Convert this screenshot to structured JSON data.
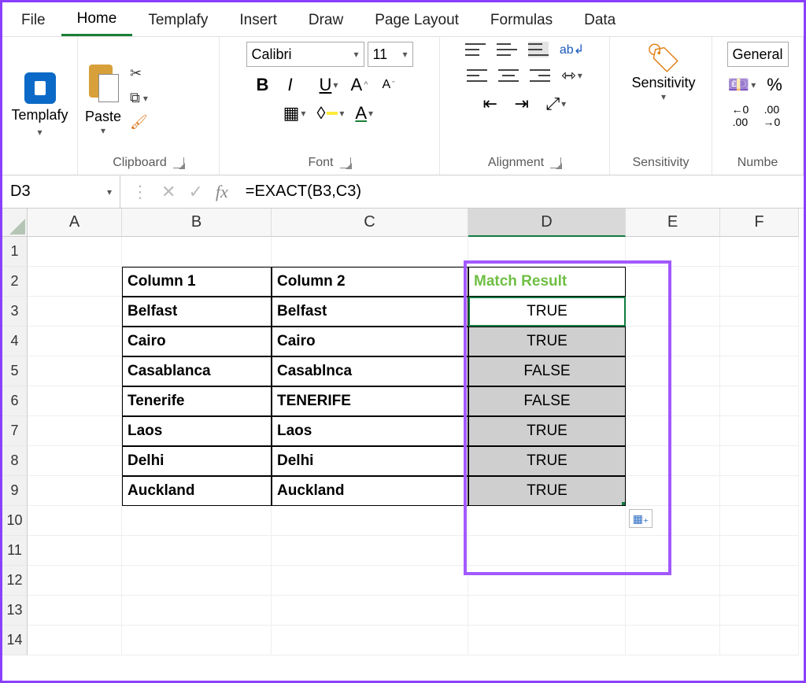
{
  "tabs": {
    "file": "File",
    "home": "Home",
    "templafy": "Templafy",
    "insert": "Insert",
    "draw": "Draw",
    "page_layout": "Page Layout",
    "formulas": "Formulas",
    "data": "Data"
  },
  "ribbon": {
    "templafy": {
      "label": "Templafy"
    },
    "clipboard": {
      "paste": "Paste",
      "label": "Clipboard"
    },
    "font": {
      "name": "Calibri",
      "size": "11",
      "bold": "B",
      "italic": "I",
      "underline": "U",
      "label": "Font"
    },
    "alignment": {
      "label": "Alignment"
    },
    "sensitivity": {
      "btn": "Sensitivity",
      "label": "Sensitivity"
    },
    "number": {
      "format": "General",
      "label": "Numbe"
    }
  },
  "formula_bar": {
    "name_box": "D3",
    "fx": "fx",
    "formula": "=EXACT(B3,C3)"
  },
  "columns": [
    "A",
    "B",
    "C",
    "D",
    "E",
    "F"
  ],
  "rows": [
    "1",
    "2",
    "3",
    "4",
    "5",
    "6",
    "7",
    "8",
    "9",
    "10",
    "11",
    "12",
    "13",
    "14"
  ],
  "chart_data": {
    "type": "table",
    "headers": [
      "Column 1",
      "Column 2",
      "Match Result"
    ],
    "rows": [
      [
        "Belfast",
        "Belfast",
        "TRUE"
      ],
      [
        "Cairo",
        "Cairo",
        "TRUE"
      ],
      [
        "Casablanca",
        "Casablnca",
        "FALSE"
      ],
      [
        "Tenerife",
        "TENERIFE",
        "FALSE"
      ],
      [
        "Laos",
        "Laos",
        "TRUE"
      ],
      [
        "Delhi",
        "Delhi",
        "TRUE"
      ],
      [
        "Auckland",
        "Auckland",
        "TRUE"
      ]
    ]
  }
}
